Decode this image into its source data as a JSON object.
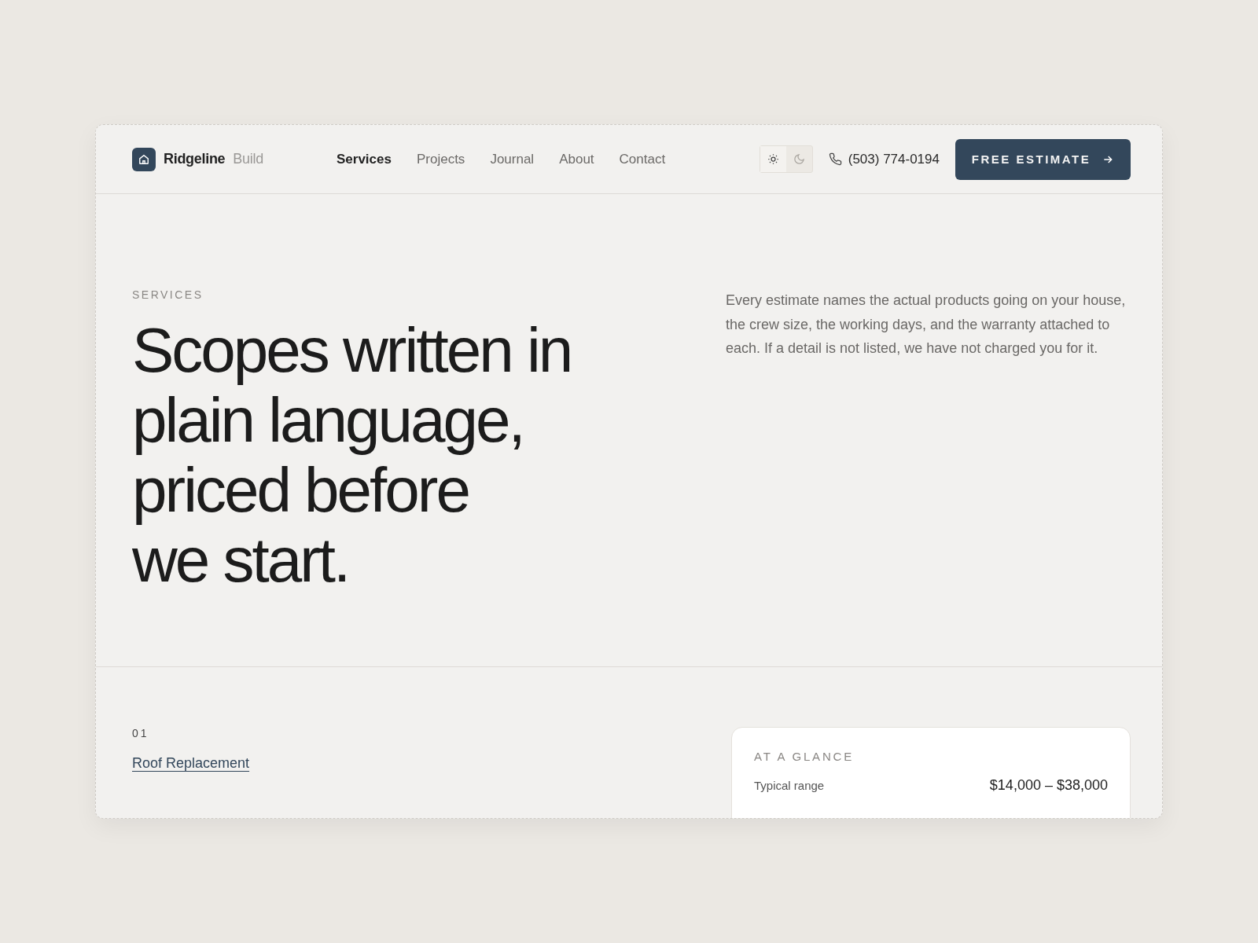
{
  "brand": {
    "name": "Ridgeline",
    "suffix": "Build"
  },
  "nav": [
    {
      "label": "Services",
      "selected": true
    },
    {
      "label": "Projects",
      "selected": false
    },
    {
      "label": "Journal",
      "selected": false
    },
    {
      "label": "About",
      "selected": false
    },
    {
      "label": "Contact",
      "selected": false
    }
  ],
  "theme_toggle": [
    {
      "kind": "light",
      "selected": true
    },
    {
      "kind": "dark",
      "selected": false
    }
  ],
  "phone": "(503) 774-0194",
  "cta": "FREE ESTIMATE",
  "hero": {
    "eyebrow": "SERVICES",
    "headline": "Scopes written in\nplain language,\npriced before\nwe start.",
    "intro": "Every estimate names the actual products going on your house, the crew size, the working days, and the warranty attached to each. If a detail is not listed, we have not charged you for it."
  },
  "service": {
    "number": "01",
    "title": "Roof Replacement"
  },
  "glance": {
    "title": "AT A GLANCE",
    "rows": [
      {
        "label": "Typical range",
        "value": "$14,000 – $38,000"
      }
    ]
  }
}
